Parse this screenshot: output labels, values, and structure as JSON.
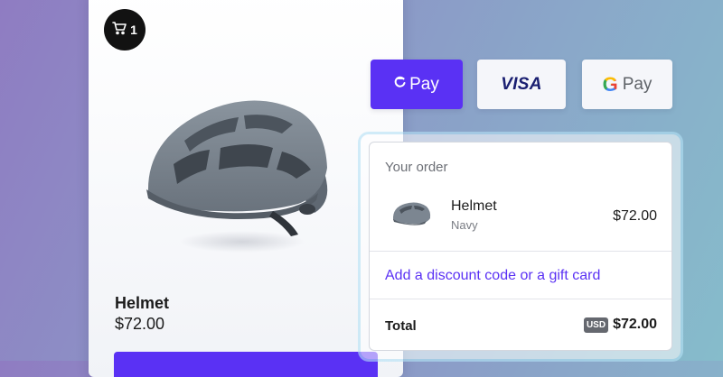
{
  "product": {
    "name": "Helmet",
    "price": "$72.00",
    "cart_count": "1",
    "image": "bike-helmet-image"
  },
  "payment_methods": {
    "shop_pay_label": "Pay",
    "visa_label": "VISA",
    "google_pay_g": "G",
    "google_pay_label": "Pay"
  },
  "order": {
    "title": "Your order",
    "item": {
      "name": "Helmet",
      "variant": "Navy",
      "price": "$72.00"
    },
    "discount_link": "Add a discount code or a gift card",
    "total_label": "Total",
    "currency": "USD",
    "total_value": "$72.00"
  },
  "colors": {
    "accent": "#5a31f4",
    "helmet": "#7c8691",
    "visa_blue": "#1a1f71"
  },
  "icons": [
    "cart-icon",
    "shop-pay-icon",
    "google-g-icon"
  ]
}
